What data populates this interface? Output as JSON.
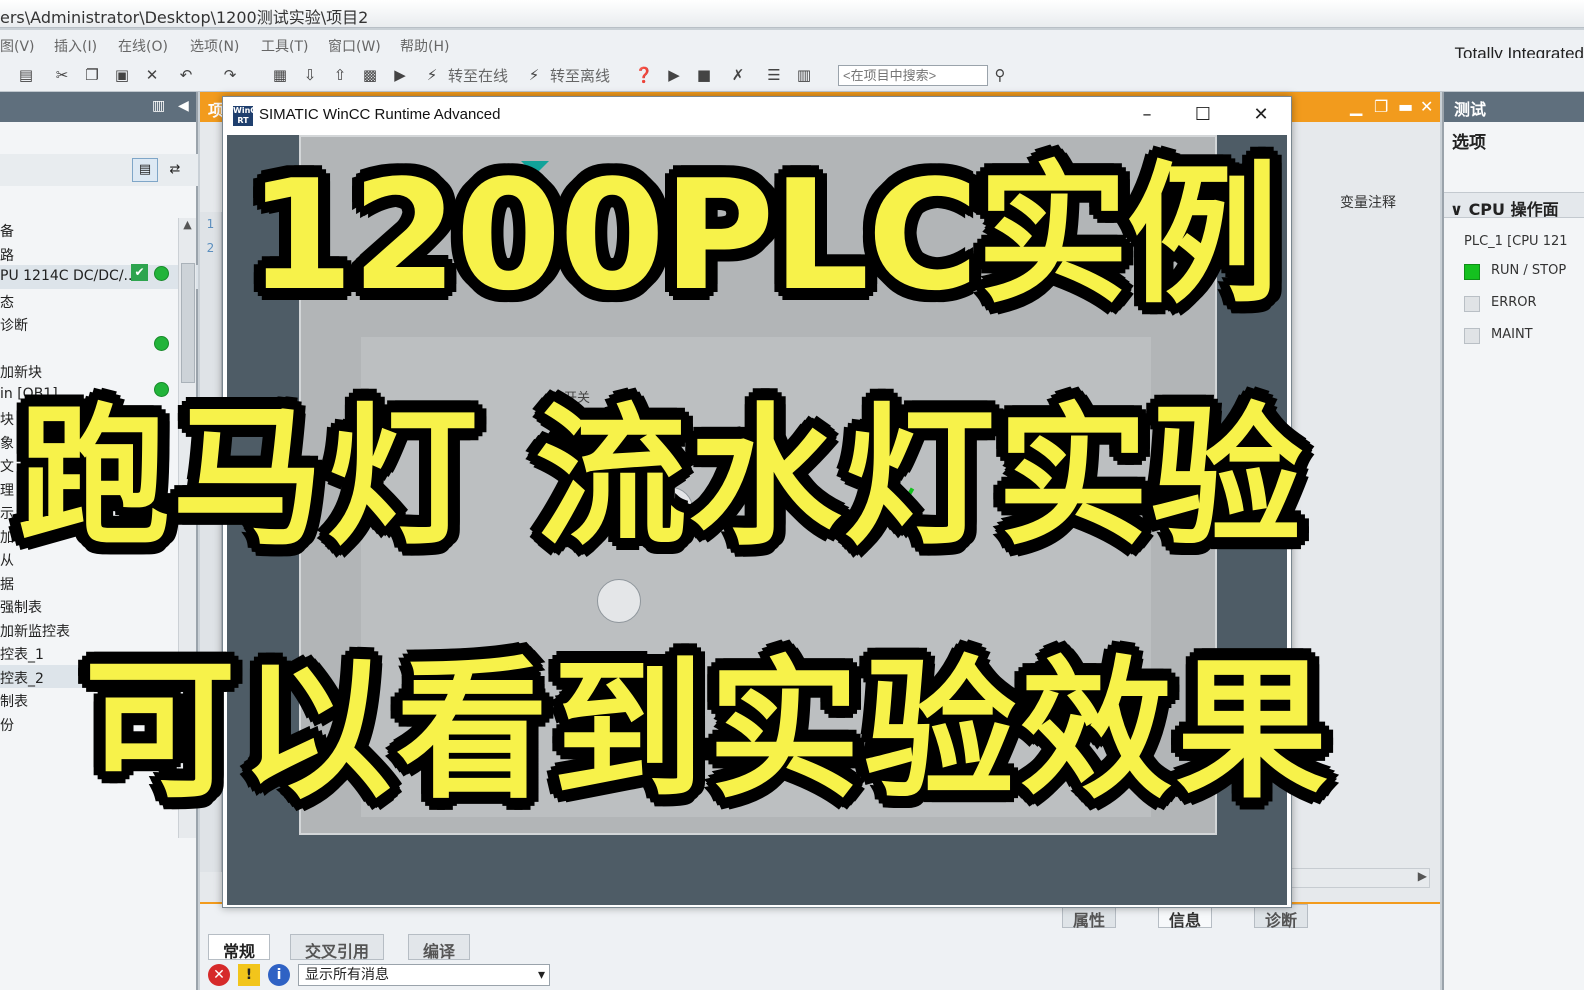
{
  "titlebar": {
    "path": "ers\\Administrator\\Desktop\\1200测试实验\\项目2"
  },
  "menu": [
    "图(V)",
    "插入(I)",
    "在线(O)",
    "选项(N)",
    "工具(T)",
    "窗口(W)",
    "帮助(H)"
  ],
  "brand": "Totally Integrated",
  "toolbar": {
    "go_online": "转至在线",
    "go_offline": "转至离线",
    "search_placeholder": "<在项目中搜索>"
  },
  "project_tree": {
    "items": [
      "备",
      "路",
      "PU 1214C DC/DC/...",
      "态",
      "诊断",
      "",
      "加新块",
      "in [OB1]",
      "块",
      "象",
      "文",
      "理",
      "示",
      "加",
      "从",
      "据",
      "强制表",
      "加新监控表",
      "控表_1",
      "控表_2",
      "制表",
      "份"
    ]
  },
  "editor": {
    "tab_label": "项",
    "row_numbers": [
      "1",
      "2"
    ],
    "column_header": "变量注释"
  },
  "right_panel": {
    "title": "测试",
    "subtitle": "选项",
    "section": "CPU 操作面",
    "plc": "PLC_1 [CPU 121",
    "leds": [
      {
        "label": "RUN / STOP",
        "on": true,
        "color": "#14c01f"
      },
      {
        "label": "ERROR",
        "on": false
      },
      {
        "label": "MAINT",
        "on": false
      }
    ]
  },
  "wincc": {
    "title": "SIMATIC WinCC Runtime Advanced",
    "logo": "WinCC RT",
    "label_switch": "有开关"
  },
  "inspector": {
    "top_tabs": [
      "属性",
      "信息",
      "诊断"
    ],
    "tabs": [
      "常规",
      "交叉引用",
      "编译"
    ],
    "filter_value": "显示所有消息"
  },
  "caption": {
    "line1": "1200PLC实例",
    "line2": "跑马灯  流水灯实验",
    "line3": "可以看到实验效果",
    "color": "#f7f24a"
  }
}
